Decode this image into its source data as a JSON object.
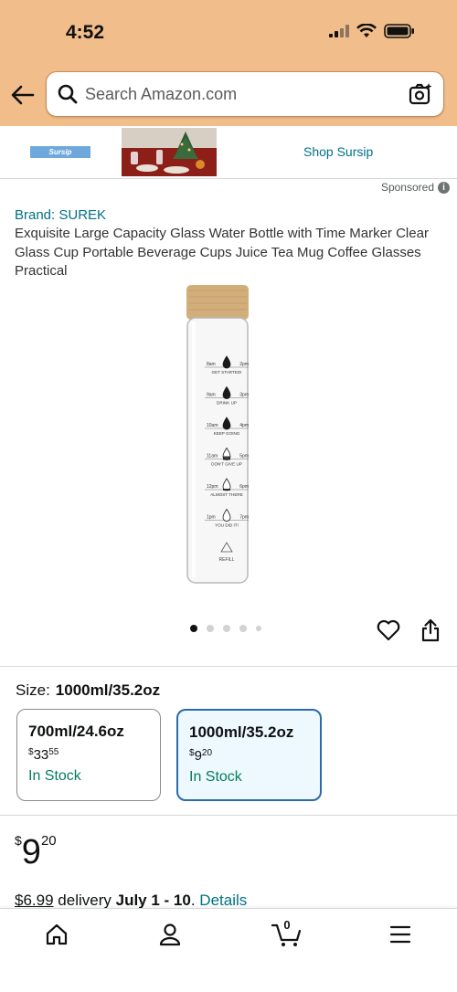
{
  "status_bar": {
    "time": "4:52"
  },
  "search": {
    "placeholder": "Search Amazon.com"
  },
  "banner": {
    "brand_logo_text": "Sursip",
    "link_label": "Shop Sursip"
  },
  "sponsored_label": "Sponsored",
  "product": {
    "brand": "Brand: SUREK",
    "title": "Exquisite Large Capacity Glass Water Bottle with Time Marker Clear Glass Cup Portable Beverage Cups Juice Tea Mug Coffee Glasses Practical",
    "bottle_markings": [
      {
        "left": "8am",
        "right": "2pm",
        "caption": "GET STARTED!"
      },
      {
        "left": "9am",
        "right": "3pm",
        "caption": "DRINK UP"
      },
      {
        "left": "10am",
        "right": "4pm",
        "caption": "KEEP GOING"
      },
      {
        "left": "11am",
        "right": "5pm",
        "caption": "DON'T GIVE UP"
      },
      {
        "left": "12pm",
        "right": "6pm",
        "caption": "ALMOST THERE"
      },
      {
        "left": "1pm",
        "right": "7pm",
        "caption": "YOU DID IT!"
      }
    ],
    "refill_label": "REFILL",
    "image_count": 5,
    "active_image": 1
  },
  "size": {
    "label": "Size:",
    "selected": "1000ml/35.2oz",
    "options": [
      {
        "name": "700ml/24.6oz",
        "currency": "$",
        "whole": "33",
        "fraction": "55",
        "stock": "In Stock",
        "selected": false
      },
      {
        "name": "1000ml/35.2oz",
        "currency": "$",
        "whole": "9",
        "fraction": "20",
        "stock": "In Stock",
        "selected": true
      }
    ]
  },
  "price": {
    "currency": "$",
    "whole": "9",
    "fraction": "20"
  },
  "delivery": {
    "fee": "$6.99",
    "word": "delivery",
    "dates": "July 1 - 10",
    "separator": ".",
    "details_link": "Details"
  },
  "bottom_nav": {
    "cart_count": "0",
    "items": [
      "home-icon",
      "account-icon",
      "cart-icon",
      "menu-icon"
    ]
  },
  "colors": {
    "header": "#f1bd8a",
    "link": "#007185",
    "in_stock": "#067d62",
    "selected_border": "#2d6aa8",
    "selected_bg": "#edf8ff"
  }
}
